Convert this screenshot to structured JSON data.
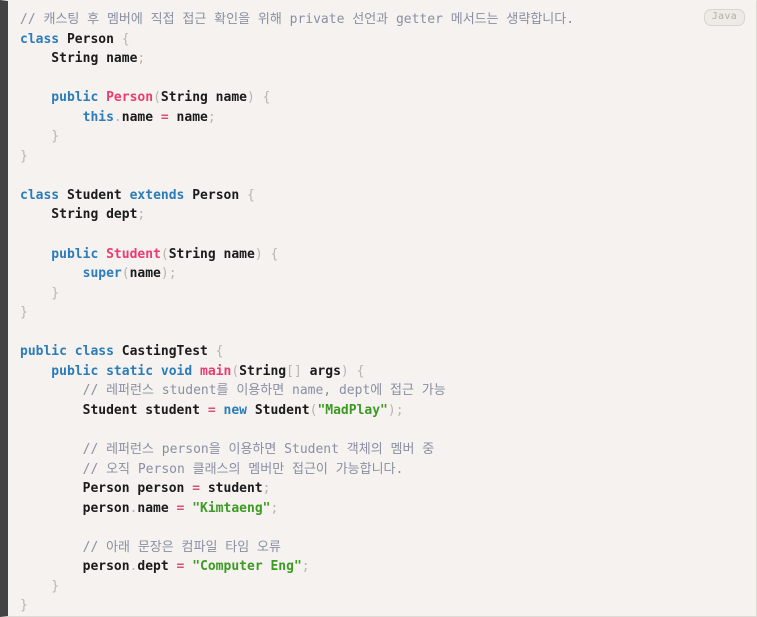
{
  "block": {
    "language_badge": "Java",
    "accent_bar_color": "#434343",
    "background_color": "#f5f2ef"
  },
  "theme": {
    "comment_color": "#8a8fa3",
    "keyword_color": "#2b7cb8",
    "method_color": "#ec3a72",
    "string_color": "#3d9b24",
    "operator_color": "#d94f78",
    "punctuation_color": "#b9b5b1",
    "text_color": "#1b1b1b"
  },
  "code": {
    "lines": [
      [
        {
          "t": "cm",
          "v": "// 캐스팅 후 멤버에 직접 접근 확인을 위해 private 선언과 getter 메서드는 생략합니다."
        }
      ],
      [
        {
          "t": "kw",
          "v": "class"
        },
        {
          "t": "id",
          "v": " Person "
        },
        {
          "t": "pn",
          "v": "{"
        }
      ],
      [
        {
          "t": "id",
          "v": "    String name"
        },
        {
          "t": "pn",
          "v": ";"
        }
      ],
      [],
      [
        {
          "t": "kw",
          "v": "    public "
        },
        {
          "t": "fn",
          "v": "Person"
        },
        {
          "t": "pn",
          "v": "("
        },
        {
          "t": "id",
          "v": "String name"
        },
        {
          "t": "pn",
          "v": ") {"
        }
      ],
      [
        {
          "t": "kw",
          "v": "        this"
        },
        {
          "t": "pn",
          "v": "."
        },
        {
          "t": "id",
          "v": "name "
        },
        {
          "t": "op",
          "v": "="
        },
        {
          "t": "id",
          "v": " name"
        },
        {
          "t": "pn",
          "v": ";"
        }
      ],
      [
        {
          "t": "pn",
          "v": "    }"
        }
      ],
      [
        {
          "t": "pn",
          "v": "}"
        }
      ],
      [],
      [
        {
          "t": "kw",
          "v": "class"
        },
        {
          "t": "id",
          "v": " Student "
        },
        {
          "t": "kw",
          "v": "extends"
        },
        {
          "t": "id",
          "v": " Person "
        },
        {
          "t": "pn",
          "v": "{"
        }
      ],
      [
        {
          "t": "id",
          "v": "    String dept"
        },
        {
          "t": "pn",
          "v": ";"
        }
      ],
      [],
      [
        {
          "t": "kw",
          "v": "    public "
        },
        {
          "t": "fn",
          "v": "Student"
        },
        {
          "t": "pn",
          "v": "("
        },
        {
          "t": "id",
          "v": "String name"
        },
        {
          "t": "pn",
          "v": ") {"
        }
      ],
      [
        {
          "t": "kw",
          "v": "        super"
        },
        {
          "t": "pn",
          "v": "("
        },
        {
          "t": "id",
          "v": "name"
        },
        {
          "t": "pn",
          "v": ");"
        }
      ],
      [
        {
          "t": "pn",
          "v": "    }"
        }
      ],
      [
        {
          "t": "pn",
          "v": "}"
        }
      ],
      [],
      [
        {
          "t": "kw",
          "v": "public class"
        },
        {
          "t": "id",
          "v": " CastingTest "
        },
        {
          "t": "pn",
          "v": "{"
        }
      ],
      [
        {
          "t": "kw",
          "v": "    public static void "
        },
        {
          "t": "fn",
          "v": "main"
        },
        {
          "t": "pn",
          "v": "("
        },
        {
          "t": "id",
          "v": "String"
        },
        {
          "t": "pn",
          "v": "[] "
        },
        {
          "t": "id",
          "v": "args"
        },
        {
          "t": "pn",
          "v": ") {"
        }
      ],
      [
        {
          "t": "cm",
          "v": "        // 레퍼런스 student를 이용하면 name, dept에 접근 가능"
        }
      ],
      [
        {
          "t": "id",
          "v": "        Student student "
        },
        {
          "t": "op",
          "v": "="
        },
        {
          "t": "kw",
          "v": " new "
        },
        {
          "t": "id",
          "v": "Student"
        },
        {
          "t": "pn",
          "v": "("
        },
        {
          "t": "st",
          "v": "\"MadPlay\""
        },
        {
          "t": "pn",
          "v": ");"
        }
      ],
      [],
      [
        {
          "t": "cm",
          "v": "        // 레퍼런스 person을 이용하면 Student 객체의 멤버 중"
        }
      ],
      [
        {
          "t": "cm",
          "v": "        // 오직 Person 클래스의 멤버만 접근이 가능합니다."
        }
      ],
      [
        {
          "t": "id",
          "v": "        Person person "
        },
        {
          "t": "op",
          "v": "="
        },
        {
          "t": "id",
          "v": " student"
        },
        {
          "t": "pn",
          "v": ";"
        }
      ],
      [
        {
          "t": "id",
          "v": "        person"
        },
        {
          "t": "pn",
          "v": "."
        },
        {
          "t": "id",
          "v": "name "
        },
        {
          "t": "op",
          "v": "="
        },
        {
          "t": "st",
          "v": " \"Kimtaeng\""
        },
        {
          "t": "pn",
          "v": ";"
        }
      ],
      [],
      [
        {
          "t": "cm",
          "v": "        // 아래 문장은 컴파일 타임 오류"
        }
      ],
      [
        {
          "t": "id",
          "v": "        person"
        },
        {
          "t": "pn",
          "v": "."
        },
        {
          "t": "id",
          "v": "dept "
        },
        {
          "t": "op",
          "v": "="
        },
        {
          "t": "st",
          "v": " \"Computer Eng\""
        },
        {
          "t": "pn",
          "v": ";"
        }
      ],
      [
        {
          "t": "pn",
          "v": "    }"
        }
      ],
      [
        {
          "t": "pn",
          "v": "}"
        }
      ]
    ],
    "plain_text": "// 캐스팅 후 멤버에 직접 접근 확인을 위해 private 선언과 getter 메서드는 생략합니다.\nclass Person {\n    String name;\n\n    public Person(String name) {\n        this.name = name;\n    }\n}\n\nclass Student extends Person {\n    String dept;\n\n    public Student(String name) {\n        super(name);\n    }\n}\n\npublic class CastingTest {\n    public static void main(String[] args) {\n        // 레퍼런스 student를 이용하면 name, dept에 접근 가능\n        Student student = new Student(\"MadPlay\");\n\n        // 레퍼런스 person을 이용하면 Student 객체의 멤버 중\n        // 오직 Person 클래스의 멤버만 접근이 가능합니다.\n        Person person = student;\n        person.name = \"Kimtaeng\";\n\n        // 아래 문장은 컴파일 타임 오류\n        person.dept = \"Computer Eng\";\n    }\n}"
  }
}
